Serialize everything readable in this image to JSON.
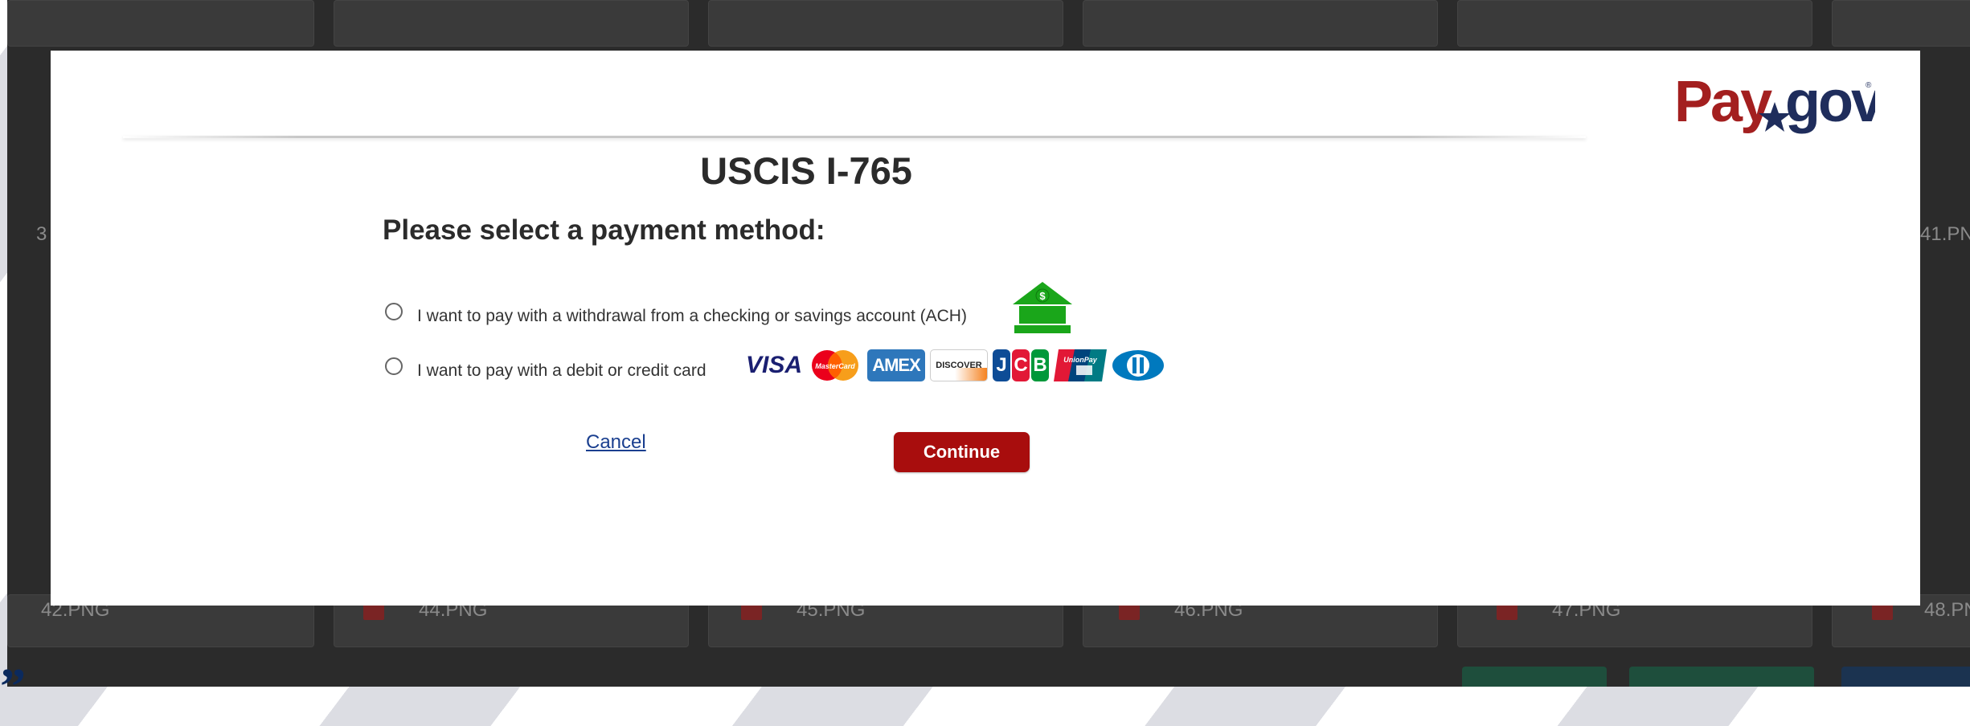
{
  "background": {
    "file_labels": [
      "3",
      "41.PN",
      "42.PNG",
      "44.PNG",
      "45.PNG",
      "46.PNG",
      "47.PNG",
      "48.PN"
    ],
    "logo_fragment": "”"
  },
  "modal": {
    "brand": "Pay.gov",
    "title": "USCIS I-765",
    "subtitle": "Please select a payment method:",
    "options": [
      {
        "label": "I want to pay with a withdrawal from a checking or savings account (ACH)",
        "icon": "bank-icon"
      },
      {
        "label": "I want to pay with a debit or credit card",
        "icon": "credit-cards-icon"
      }
    ],
    "card_brands": [
      "VISA",
      "MasterCard",
      "AMEX",
      "DISCOVER",
      "JCB",
      "UnionPay",
      "Diners Club"
    ],
    "cancel_label": "Cancel",
    "continue_label": "Continue"
  },
  "colors": {
    "brand_red": "#a80d0d",
    "brand_navy": "#1f2d5c",
    "link_blue": "#1a3f8f",
    "overlay": "#2b2b2b"
  }
}
